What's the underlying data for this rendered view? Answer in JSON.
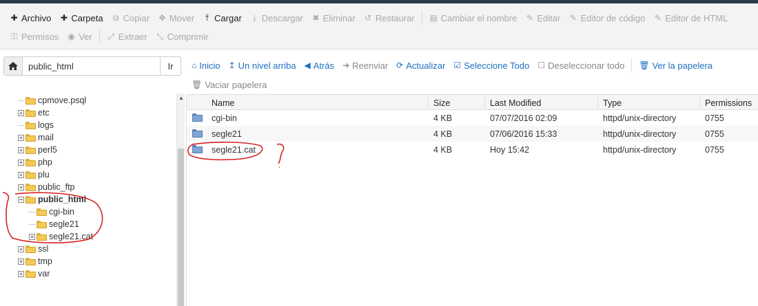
{
  "toolbar": {
    "row1": [
      {
        "icon": "plus-icon",
        "glyph": "✚",
        "label": "Archivo",
        "enabled": true
      },
      {
        "icon": "plus-icon",
        "glyph": "✚",
        "label": "Carpeta",
        "enabled": true
      },
      {
        "icon": "copy-icon",
        "glyph": "⧉",
        "label": "Copiar",
        "enabled": false
      },
      {
        "icon": "move-icon",
        "glyph": "✥",
        "label": "Mover",
        "enabled": false
      },
      {
        "icon": "upload-icon",
        "glyph": "⤒",
        "label": "Cargar",
        "enabled": true
      },
      {
        "icon": "download-icon",
        "glyph": "⤓",
        "label": "Descargar",
        "enabled": false
      },
      {
        "icon": "delete-icon",
        "glyph": "✖",
        "label": "Eliminar",
        "enabled": false
      },
      {
        "icon": "restore-icon",
        "glyph": "↺",
        "label": "Restaurar",
        "enabled": false
      },
      {
        "icon": "file-icon",
        "glyph": "▤",
        "label": "Cambiar el nombre",
        "enabled": false
      },
      {
        "icon": "pencil-icon",
        "glyph": "✎",
        "label": "Editar",
        "enabled": false
      },
      {
        "icon": "edit-icon",
        "glyph": "✎",
        "label": "Editor de código",
        "enabled": false
      },
      {
        "icon": "edit-icon",
        "glyph": "✎",
        "label": "Editor de HTML",
        "enabled": false
      }
    ],
    "row2": [
      {
        "icon": "key-icon",
        "glyph": "⚿",
        "label": "Permisos",
        "enabled": false
      },
      {
        "icon": "eye-icon",
        "glyph": "◉",
        "label": "Ver",
        "enabled": false
      },
      {
        "icon": "expand-icon",
        "glyph": "⤢",
        "label": "Extraer",
        "enabled": false
      },
      {
        "icon": "compress-icon",
        "glyph": "⤡",
        "label": "Comprimir",
        "enabled": false
      }
    ]
  },
  "pathbar": {
    "value": "public_html",
    "go_label": "Ir"
  },
  "nav": {
    "row1": [
      {
        "icon": "home-icon",
        "glyph": "⌂",
        "label": "Inicio",
        "enabled": true
      },
      {
        "icon": "level-up-icon",
        "glyph": "↥",
        "label": "Un nivel arriba",
        "enabled": true
      },
      {
        "icon": "arrow-left-icon",
        "glyph": "◀",
        "label": "Atrás",
        "enabled": true
      },
      {
        "icon": "arrow-right-icon",
        "glyph": "➔",
        "label": "Reenviar",
        "enabled": false
      },
      {
        "icon": "refresh-icon",
        "glyph": "⟳",
        "label": "Actualizar",
        "enabled": true
      },
      {
        "icon": "checkbox-checked-icon",
        "glyph": "☑",
        "label": "Seleccione Todo",
        "enabled": true
      },
      {
        "icon": "checkbox-empty-icon",
        "glyph": "☐",
        "label": "Deseleccionar todo",
        "enabled": false
      },
      {
        "icon": "trash-icon",
        "glyph": "🗑",
        "label": "Ver la papelera",
        "enabled": true
      }
    ],
    "row2": [
      {
        "icon": "trash-icon",
        "glyph": "🗑",
        "label": "Vaciar papelera",
        "enabled": false
      }
    ]
  },
  "tree": [
    {
      "label": "cpmove.psql",
      "expandable": false,
      "indent": 0,
      "bold": false
    },
    {
      "label": "etc",
      "expandable": true,
      "indent": 0,
      "bold": false
    },
    {
      "label": "logs",
      "expandable": false,
      "indent": 0,
      "bold": false
    },
    {
      "label": "mail",
      "expandable": true,
      "indent": 0,
      "bold": false
    },
    {
      "label": "perl5",
      "expandable": true,
      "indent": 0,
      "bold": false
    },
    {
      "label": "php",
      "expandable": true,
      "indent": 0,
      "bold": false
    },
    {
      "label": "plu",
      "expandable": true,
      "indent": 0,
      "bold": false
    },
    {
      "label": "public_ftp",
      "expandable": true,
      "indent": 0,
      "bold": false
    },
    {
      "label": "public_html",
      "expandable": true,
      "expanded": true,
      "indent": 0,
      "bold": true
    },
    {
      "label": "cgi-bin",
      "expandable": false,
      "indent": 1,
      "bold": false
    },
    {
      "label": "segle21",
      "expandable": false,
      "indent": 1,
      "bold": false
    },
    {
      "label": "segle21.cat",
      "expandable": true,
      "indent": 1,
      "bold": false
    },
    {
      "label": "ssl",
      "expandable": true,
      "indent": 0,
      "bold": false
    },
    {
      "label": "tmp",
      "expandable": true,
      "indent": 0,
      "bold": false
    },
    {
      "label": "var",
      "expandable": true,
      "indent": 0,
      "bold": false
    }
  ],
  "table": {
    "headers": {
      "name": "Name",
      "size": "Size",
      "modified": "Last Modified",
      "type": "Type",
      "permissions": "Permissions"
    },
    "rows": [
      {
        "name": "cgi-bin",
        "size": "4 KB",
        "modified": "07/07/2016 02:09",
        "type": "httpd/unix-directory",
        "permissions": "0755"
      },
      {
        "name": "segle21",
        "size": "4 KB",
        "modified": "07/06/2016 15:33",
        "type": "httpd/unix-directory",
        "permissions": "0755"
      },
      {
        "name": "segle21.cat",
        "size": "4 KB",
        "modified": "Hoy 15:42",
        "type": "httpd/unix-directory",
        "permissions": "0755"
      }
    ]
  },
  "colors": {
    "link": "#1f6fbf",
    "annotation": "#d62020",
    "folder_yellow": "#f2ca58",
    "folder_blue": "#7ea6d4"
  }
}
